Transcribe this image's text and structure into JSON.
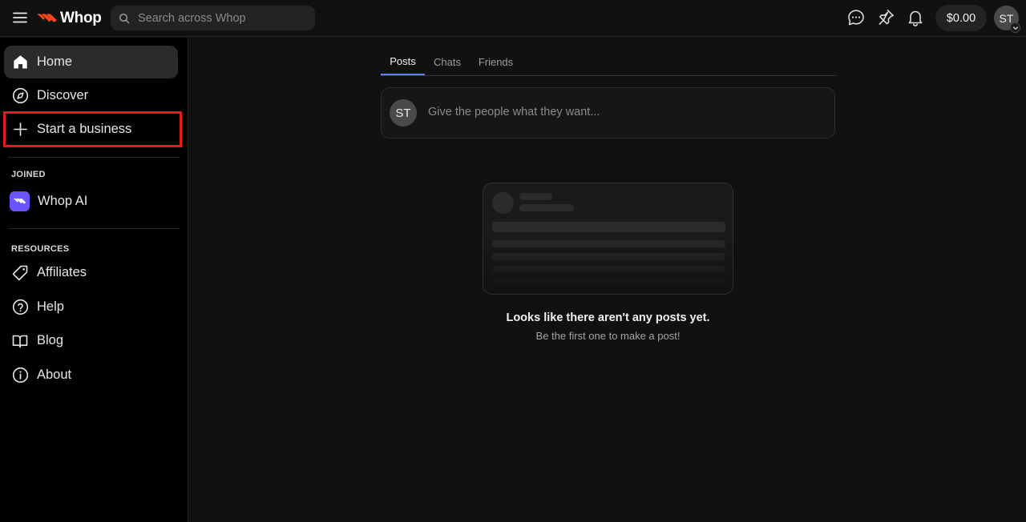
{
  "header": {
    "brand": "Whop",
    "search_placeholder": "Search across Whop",
    "balance": "$0.00",
    "avatar_initials": "ST",
    "icons": [
      "menu-icon",
      "whop-logo-icon",
      "search-icon",
      "messages-icon",
      "pin-icon",
      "bell-icon",
      "chevron-down-icon"
    ]
  },
  "sidebar": {
    "nav": [
      {
        "label": "Home",
        "icon": "home-icon",
        "active": true
      },
      {
        "label": "Discover",
        "icon": "compass-icon"
      },
      {
        "label": "Start a business",
        "icon": "plus-icon"
      }
    ],
    "joined_label": "JOINED",
    "joined": [
      {
        "label": "Whop AI",
        "icon": "whop-ai-icon"
      }
    ],
    "resources_label": "RESOURCES",
    "resources": [
      {
        "label": "Affiliates",
        "icon": "tag-icon"
      },
      {
        "label": "Help",
        "icon": "help-icon"
      },
      {
        "label": "Blog",
        "icon": "book-icon"
      },
      {
        "label": "About",
        "icon": "info-icon"
      }
    ]
  },
  "main": {
    "tabs": [
      {
        "label": "Posts",
        "active": true
      },
      {
        "label": "Chats"
      },
      {
        "label": "Friends"
      }
    ],
    "composer": {
      "avatar_initials": "ST",
      "placeholder": "Give the people what they want..."
    },
    "empty_state": {
      "title": "Looks like there aren't any posts yet.",
      "subtitle": "Be the first one to make a post!"
    }
  },
  "colors": {
    "accent": "#5a86f5",
    "brand": "#fa4616",
    "highlight": "#e3191e",
    "whop_ai": "#6b54ff"
  }
}
